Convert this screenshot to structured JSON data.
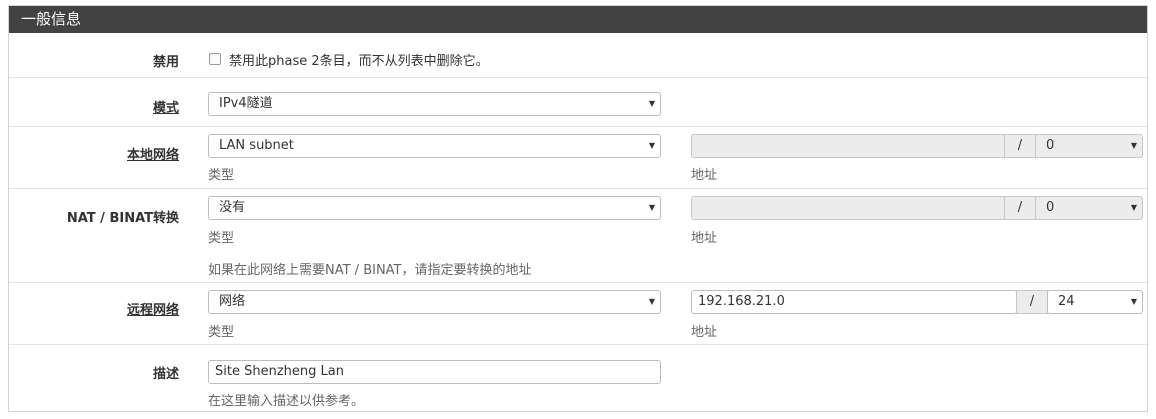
{
  "panel": {
    "title": "一般信息"
  },
  "disabled": {
    "label": "禁用",
    "checkbox_label": "禁用此phase 2条目，而不从列表中删除它。",
    "checked": false
  },
  "mode": {
    "label": "模式",
    "value": "IPv4隧道"
  },
  "local_network": {
    "label": "本地网络",
    "type_value": "LAN subnet",
    "type_help": "类型",
    "address_value": "",
    "slash": "/",
    "mask_value": "0",
    "address_help": "地址"
  },
  "nat": {
    "label": "NAT / BINAT转换",
    "type_value": "没有",
    "type_help": "类型",
    "address_value": "",
    "slash": "/",
    "mask_value": "0",
    "address_help": "地址",
    "note": "如果在此网络上需要NAT / BINAT，请指定要转换的地址"
  },
  "remote_network": {
    "label": "远程网络",
    "type_value": "网络",
    "type_help": "类型",
    "address_value": "192.168.21.0",
    "slash": "/",
    "mask_value": "24",
    "address_help": "地址"
  },
  "description": {
    "label": "描述",
    "value": "Site Shenzheng Lan",
    "help": "在这里输入描述以供参考。"
  },
  "icons": {
    "caret": "caret-down-icon"
  }
}
